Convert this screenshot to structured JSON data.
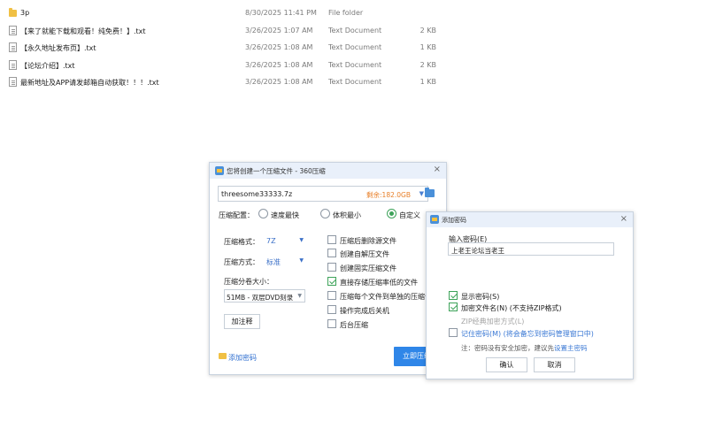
{
  "files": [
    {
      "icon": "folder-icon",
      "name": "3p",
      "date": "8/30/2025 11:41 PM",
      "type": "File folder",
      "size": ""
    },
    {
      "icon": "text-file-icon",
      "name": "【来了就能下载和观看！纯免费！】.txt",
      "date": "3/26/2025 1:07 AM",
      "type": "Text Document",
      "size": "2 KB"
    },
    {
      "icon": "text-file-icon",
      "name": "【永久地址发布页】.txt",
      "date": "3/26/2025 1:08 AM",
      "type": "Text Document",
      "size": "1 KB"
    },
    {
      "icon": "text-file-icon",
      "name": "【论坛介绍】.txt",
      "date": "3/26/2025 1:08 AM",
      "type": "Text Document",
      "size": "2 KB"
    },
    {
      "icon": "text-file-icon",
      "name": "最新地址及APP请发邮箱自动获取！！！.txt",
      "date": "3/26/2025 1:08 AM",
      "type": "Text Document",
      "size": "1 KB"
    }
  ],
  "compress_dialog": {
    "title": "您将创建一个压缩文件 - 360压缩",
    "close": "×",
    "archive_name": "threesome33333.7z",
    "free_space": "剩余:182.0GB",
    "dropdown_arrow": "▼",
    "config_label": "压缩配置：",
    "modes": [
      {
        "label": "速度最快",
        "checked": false
      },
      {
        "label": "体积最小",
        "checked": false
      },
      {
        "label": "自定义",
        "checked": true
      }
    ],
    "format_label": "压缩格式：",
    "format_value": "7Z",
    "method_label": "压缩方式：",
    "method_value": "标准",
    "volume_label": "压缩分卷大小：",
    "volume_value": "51MB  - 双层DVD刻录",
    "comment_button": "加注释",
    "options": [
      {
        "label": "压缩后删除源文件",
        "checked": false
      },
      {
        "label": "创建自解压文件",
        "checked": false
      },
      {
        "label": "创建固实压缩文件",
        "checked": false
      },
      {
        "label": "直接存储压缩率低的文件",
        "checked": true
      },
      {
        "label": "压缩每个文件到单独的压缩包",
        "checked": false
      },
      {
        "label": "操作完成后关机",
        "checked": false
      },
      {
        "label": "后台压缩",
        "checked": false
      }
    ],
    "add_password": "添加密码",
    "compress_button": "立即压缩"
  },
  "password_dialog": {
    "title": "添加密码",
    "close": "×",
    "input_label": "输入密码(E)",
    "password_value": "上老王论坛当老王",
    "options": [
      {
        "label": "显示密码(S)",
        "checked": true,
        "disabled": false,
        "link": false
      },
      {
        "label": "加密文件名(N) (不支持ZIP格式)",
        "checked": true,
        "disabled": false,
        "link": false
      },
      {
        "label": "ZIP经典加密方式(L)",
        "checked": false,
        "disabled": true,
        "link": false
      },
      {
        "label": "记住密码(M) (将会备忘到密码管理窗口中)",
        "checked": false,
        "disabled": false,
        "link": true
      }
    ],
    "note_prefix": "注：密码没有安全加密，建议先",
    "note_link": "设置主密码",
    "ok_button": "确认",
    "cancel_button": "取消"
  }
}
